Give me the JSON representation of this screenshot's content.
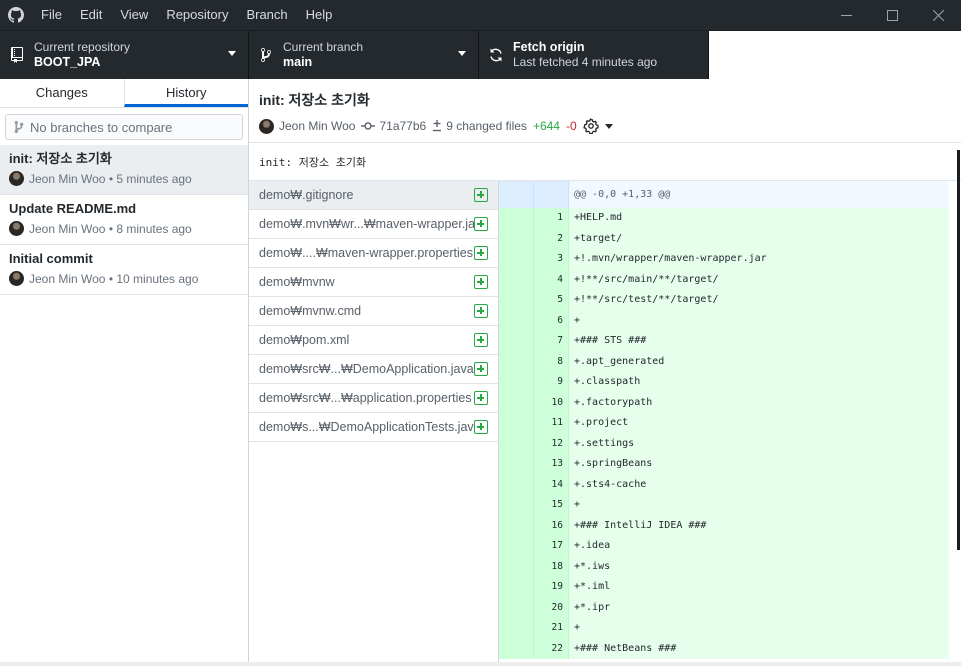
{
  "menu": [
    "File",
    "Edit",
    "View",
    "Repository",
    "Branch",
    "Help"
  ],
  "toolbar": {
    "repo_label": "Current repository",
    "repo_value": "BOOT_JPA",
    "branch_label": "Current branch",
    "branch_value": "main",
    "fetch_label": "Fetch origin",
    "fetch_sub": "Last fetched 4 minutes ago"
  },
  "sidebar": {
    "tabs": [
      "Changes",
      "History"
    ],
    "compare_placeholder": "No branches to compare",
    "commits": [
      {
        "title": "init: 저장소 초기화",
        "meta": "Jeon Min Woo • 5 minutes ago"
      },
      {
        "title": "Update README.md",
        "meta": "Jeon Min Woo • 8 minutes ago"
      },
      {
        "title": "Initial commit",
        "meta": "Jeon Min Woo • 10 minutes ago"
      }
    ]
  },
  "commit": {
    "title": "init: 저장소 초기화",
    "author": "Jeon Min Woo",
    "sha": "71a77b6",
    "changed": "9 changed files",
    "additions": "+644",
    "deletions": "-0",
    "body": "init: 저장소 초기화"
  },
  "files": [
    "demo₩.gitignore",
    "demo₩.mvn₩wr...₩maven-wrapper.jar",
    "demo₩....₩maven-wrapper.properties",
    "demo₩mvnw",
    "demo₩mvnw.cmd",
    "demo₩pom.xml",
    "demo₩src₩...₩DemoApplication.java",
    "demo₩src₩...₩application.properties",
    "demo₩s...₩DemoApplicationTests.java"
  ],
  "diff": {
    "hunk": "@@ -0,0 +1,33 @@",
    "lines": [
      {
        "n": "1",
        "code": "+HELP.md"
      },
      {
        "n": "2",
        "code": "+target/"
      },
      {
        "n": "3",
        "code": "+!.mvn/wrapper/maven-wrapper.jar"
      },
      {
        "n": "4",
        "code": "+!**/src/main/**/target/"
      },
      {
        "n": "5",
        "code": "+!**/src/test/**/target/"
      },
      {
        "n": "6",
        "code": "+"
      },
      {
        "n": "7",
        "code": "+### STS ###"
      },
      {
        "n": "8",
        "code": "+.apt_generated"
      },
      {
        "n": "9",
        "code": "+.classpath"
      },
      {
        "n": "10",
        "code": "+.factorypath"
      },
      {
        "n": "11",
        "code": "+.project"
      },
      {
        "n": "12",
        "code": "+.settings"
      },
      {
        "n": "13",
        "code": "+.springBeans"
      },
      {
        "n": "14",
        "code": "+.sts4-cache"
      },
      {
        "n": "15",
        "code": "+"
      },
      {
        "n": "16",
        "code": "+### IntelliJ IDEA ###"
      },
      {
        "n": "17",
        "code": "+.idea"
      },
      {
        "n": "18",
        "code": "+*.iws"
      },
      {
        "n": "19",
        "code": "+*.iml"
      },
      {
        "n": "20",
        "code": "+*.ipr"
      },
      {
        "n": "21",
        "code": "+"
      },
      {
        "n": "22",
        "code": "+### NetBeans ###"
      }
    ]
  }
}
